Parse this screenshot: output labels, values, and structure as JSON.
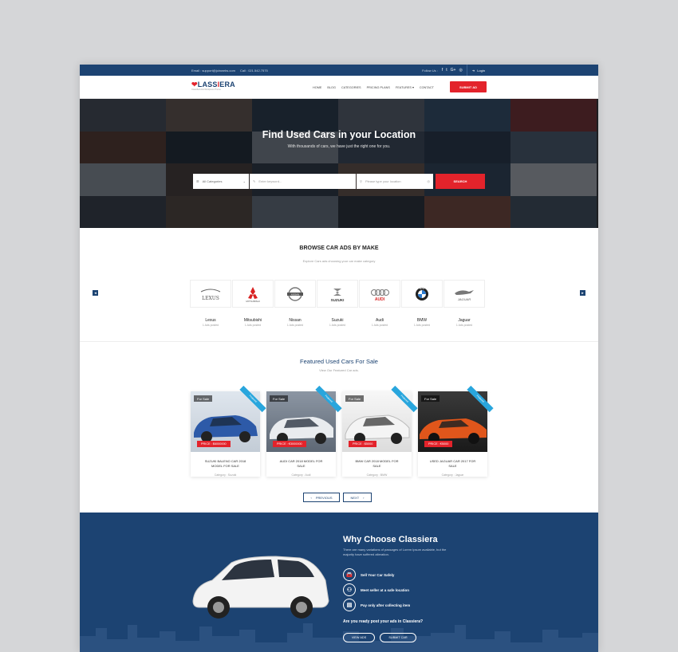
{
  "topbar": {
    "email": "Email : support@joinwebs.com",
    "call": "Call : 021.542.7575",
    "follow": "Follow Us :",
    "social": [
      "f",
      "t",
      "G+",
      "◎"
    ],
    "login": "Login"
  },
  "header": {
    "logo_a": "C",
    "logo_b": "LASS",
    "logo_c": "I",
    "logo_d": "ERA",
    "tagline": "Classified Ads Wordpress Theme",
    "nav": [
      "Home",
      "Blog",
      "Categories",
      "Pricing Plans",
      "Features ▾",
      "Contact"
    ],
    "submit": "SUBMIT AD"
  },
  "hero": {
    "title": "Find Used Cars in your Location",
    "subtitle": "With thousands of cars, we have just the right one for you.",
    "category_select": "All Categories",
    "keyword_placeholder": "Enter keyword...",
    "location_placeholder": "Please type your location",
    "search_button": "SEARCH"
  },
  "makes": {
    "title": "BROWSE CAR ADS BY MAKE",
    "subtitle": "Explore Cars ads choosing your car make category",
    "items": [
      {
        "name": "Lexus",
        "count": "1 Ads posted",
        "logo": "LEXUS"
      },
      {
        "name": "Mitsubishi",
        "count": "1 Ads posted",
        "logo": "MITSUBISHI"
      },
      {
        "name": "Nissan",
        "count": "1 Ads posted",
        "logo": "NISSAN"
      },
      {
        "name": "Suzuki",
        "count": "1 Ads posted",
        "logo": "SUZUKI"
      },
      {
        "name": "Audi",
        "count": "1 Ads posted",
        "logo": "AUDI"
      },
      {
        "name": "BMW",
        "count": "1 Ads posted",
        "logo": "BMW"
      },
      {
        "name": "Jaguar",
        "count": "1 Ads posted",
        "logo": "JAGUAR"
      }
    ]
  },
  "featured": {
    "title": "Featured Used Cars For Sale",
    "subtitle": "View Our Featured Car ads.",
    "badge": "For Sale",
    "ribbon": "Featured",
    "cards": [
      {
        "price": "PRICE : $6000000",
        "title": "SUZUKI BALENO CAR 2018 MODEL FOR SALE",
        "category": "Category : Suzuki",
        "color": "#2d5aa8"
      },
      {
        "price": "PRICE : €3000000",
        "title": "AUDI CAR 2018 MODEL FOR SALE",
        "category": "Category : Audi",
        "color": "#e9ecef"
      },
      {
        "price": "PRICE : $5000",
        "title": "BMW CAR 2018 MODEL FOR SALE",
        "category": "Category : BMW",
        "color": "#f4f4f4"
      },
      {
        "price": "PRICE : €5000",
        "title": "USED JAGUAR CAR 2017 FOR SALE",
        "category": "Category : Jaguar",
        "color": "#e0561b"
      }
    ],
    "prev": "PREVIOUS",
    "next": "NEXT"
  },
  "why": {
    "title": "Why Choose Classiera",
    "description": "There are many variations of passages of Lorem Ipsum available, but the majority have suffered alteration.",
    "features": [
      "Sell Your Car Safely",
      "Meet seller at a safe location",
      "Pay only after collecting item"
    ],
    "question": "Are you ready post your ads in Classiera?",
    "view_ads": "VIEW ADS",
    "submit_car": "SUBMIT CAR"
  },
  "colors": {
    "primary": "#1c4372",
    "accent": "#e3232b",
    "ribbon": "#29a6dd"
  }
}
